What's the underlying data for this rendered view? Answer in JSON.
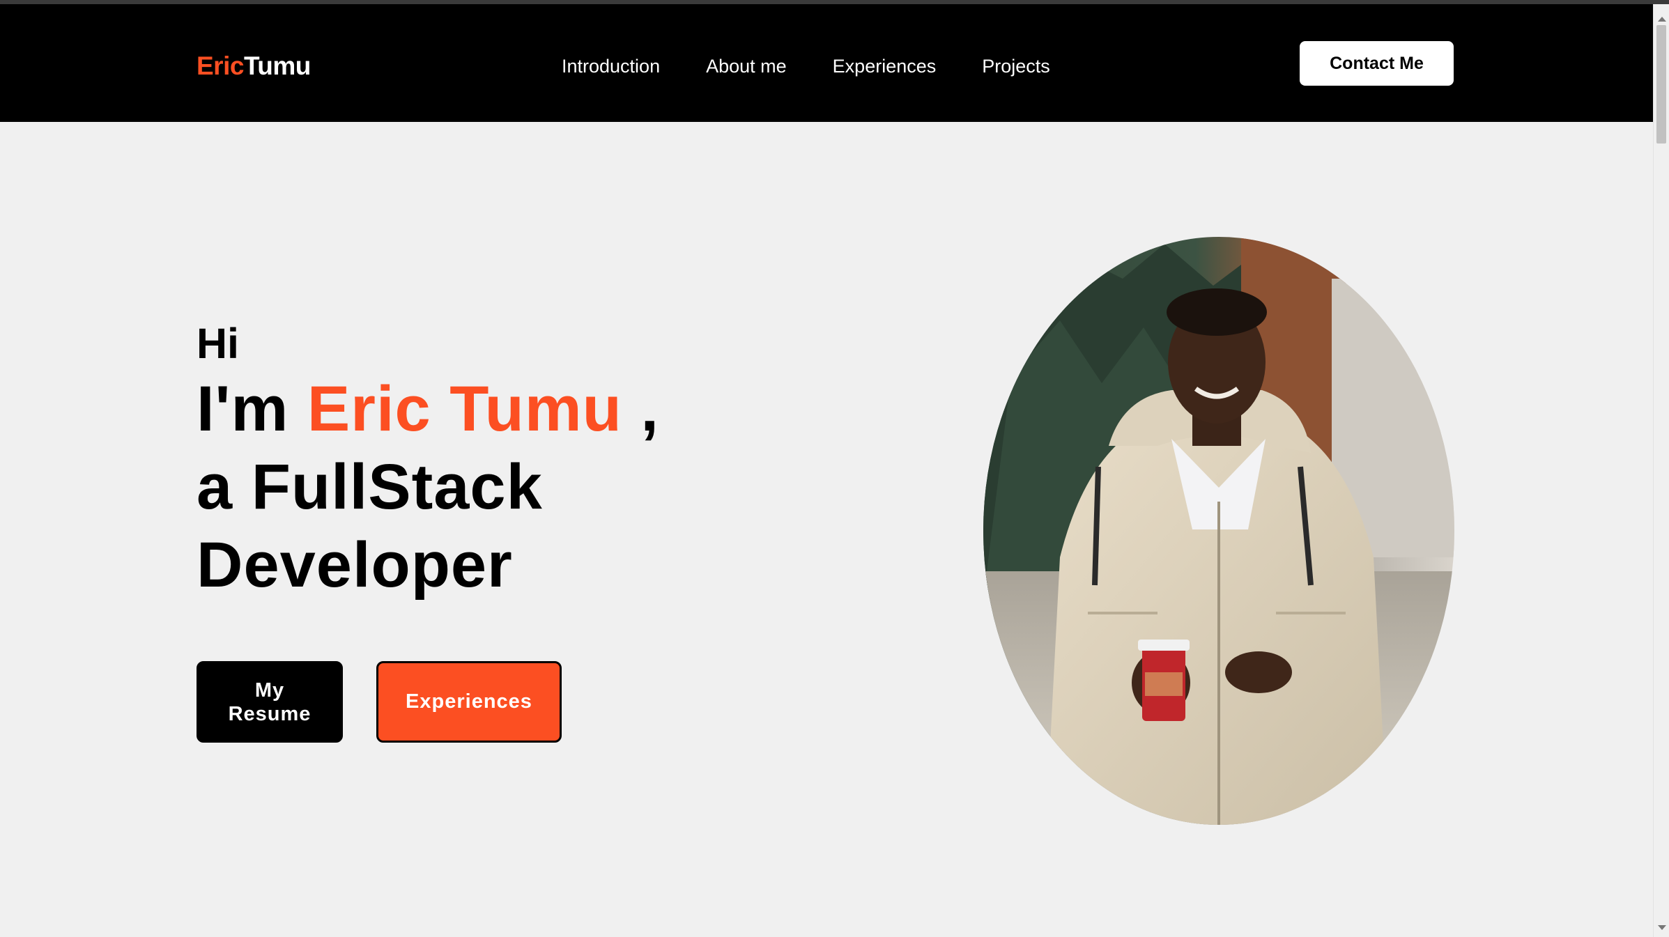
{
  "brand": {
    "first": "Eric",
    "last": "Tumu",
    "accent_color": "#fc4f22"
  },
  "nav": {
    "links": [
      {
        "label": "Introduction"
      },
      {
        "label": "About me"
      },
      {
        "label": "Experiences"
      },
      {
        "label": "Projects"
      }
    ],
    "contact_label": "Contact Me"
  },
  "hero": {
    "greeting": "Hi",
    "line1_prefix": "I'm ",
    "name": "Eric Tumu",
    "line1_suffix": " ,",
    "line2": "a FullStack",
    "line3": "Developer",
    "resume_line1": "My",
    "resume_line2": "Resume",
    "experiences_label": "Experiences"
  },
  "portrait": {
    "icon": "profile-photo"
  }
}
